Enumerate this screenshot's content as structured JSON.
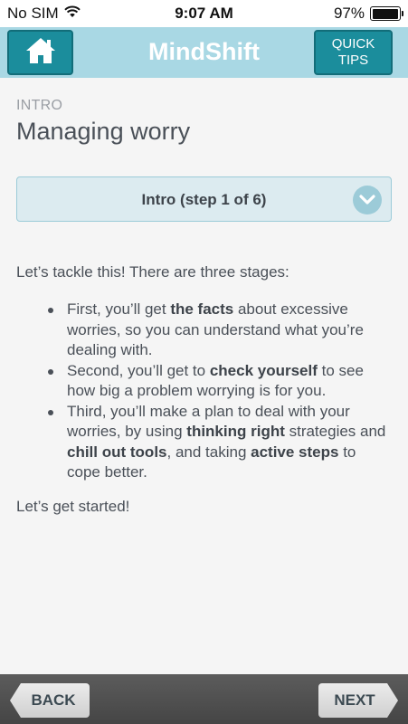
{
  "status_bar": {
    "carrier": "No SIM",
    "time": "9:07 AM",
    "battery_text": "97%",
    "battery_level": 0.97
  },
  "header": {
    "title": "MindShift",
    "quick_tips_line1": "QUICK",
    "quick_tips_line2": "TIPS",
    "accent_color": "#1b8d9c",
    "bar_color": "#a9d8e4"
  },
  "page": {
    "section": "INTRO",
    "title": "Managing worry",
    "step_selector": "Intro (step 1 of 6)",
    "intro": "Let’s tackle this! There are three stages:",
    "stages": [
      {
        "parts": [
          {
            "text": "First, you’ll get ",
            "bold": false
          },
          {
            "text": "the facts",
            "bold": true
          },
          {
            "text": " about excessive worries, so you can understand what you’re dealing with.",
            "bold": false
          }
        ]
      },
      {
        "parts": [
          {
            "text": "Second, you’ll get to ",
            "bold": false
          },
          {
            "text": "check yourself",
            "bold": true
          },
          {
            "text": " to see how big a problem worrying is for you.",
            "bold": false
          }
        ]
      },
      {
        "parts": [
          {
            "text": "Third, you’ll make a plan to deal with your worries, by using ",
            "bold": false
          },
          {
            "text": "thinking right",
            "bold": true
          },
          {
            "text": " strategies and ",
            "bold": false
          },
          {
            "text": "chill out tools",
            "bold": true
          },
          {
            "text": ", and taking ",
            "bold": false
          },
          {
            "text": "active steps",
            "bold": true
          },
          {
            "text": " to cope better.",
            "bold": false
          }
        ]
      }
    ],
    "closing": "Let’s get started!"
  },
  "footer": {
    "back_label": "BACK",
    "next_label": "NEXT"
  }
}
